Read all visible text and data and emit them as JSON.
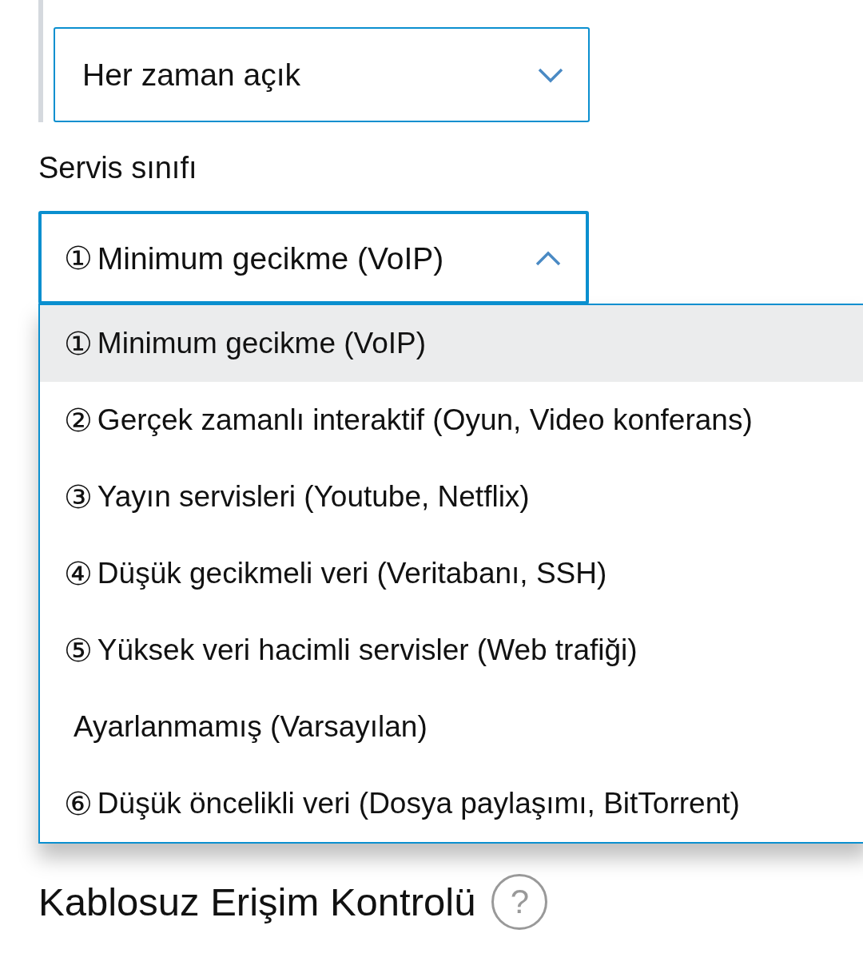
{
  "mode_select": {
    "value": "Her zaman açık",
    "expanded": false
  },
  "service_class": {
    "label": "Servis sınıfı",
    "value_number": "①",
    "value": "Minimum gecikme (VoIP)",
    "expanded": true,
    "options": [
      {
        "number": "①",
        "label": "Minimum gecikme (VoIP)",
        "selected": true
      },
      {
        "number": "②",
        "label": "Gerçek zamanlı interaktif (Oyun, Video konferans)",
        "selected": false
      },
      {
        "number": "③",
        "label": "Yayın servisleri (Youtube, Netflix)",
        "selected": false
      },
      {
        "number": "④",
        "label": "Düşük gecikmeli veri (Veritabanı, SSH)",
        "selected": false
      },
      {
        "number": "⑤",
        "label": "Yüksek veri hacimli servisler (Web trafiği)",
        "selected": false
      },
      {
        "label": "Ayarlanmamış (Varsayılan)",
        "selected": false
      },
      {
        "number": "⑥",
        "label": "Düşük öncelikli veri (Dosya paylaşımı, BitTorrent)",
        "selected": false
      }
    ]
  },
  "section": {
    "title": "Kablosuz Erişim Kontrolü",
    "help": "?"
  }
}
